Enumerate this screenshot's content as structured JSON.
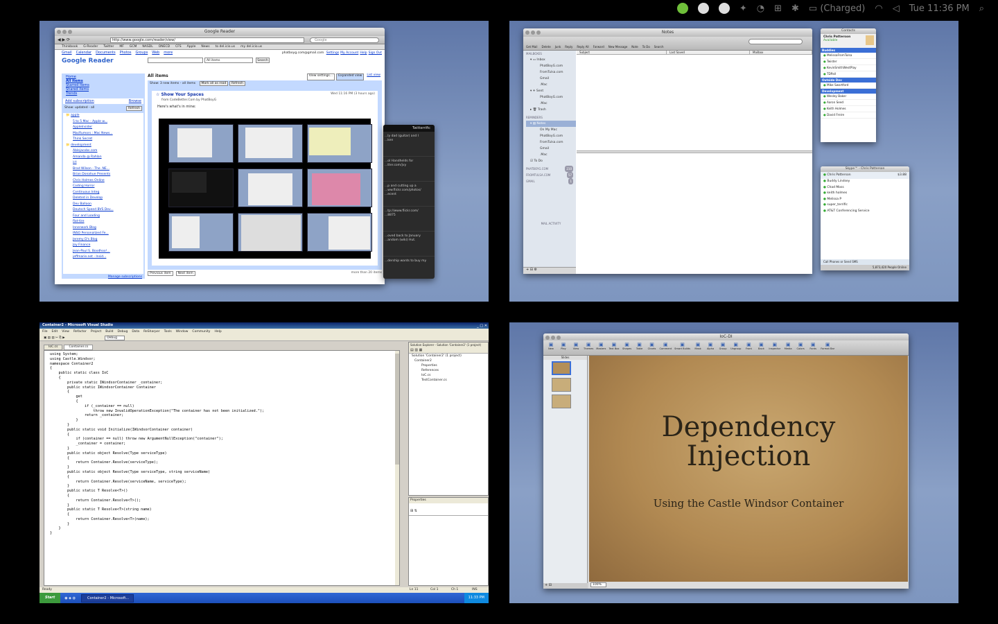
{
  "menubar": {
    "status": "(Charged)",
    "clock": "Tue 11:36 PM"
  },
  "reader": {
    "window_title": "Google Reader",
    "url": "http://www.google.com/reader/view/",
    "search_placeholder": "Google",
    "bookmarks": [
      "Thinkbook",
      "G-Reader",
      "Twitter",
      "MF",
      "GCM",
      "NASDL",
      "ONECD",
      "CFS",
      "Apple",
      "News",
      "to del.icio.us",
      "my del.icio.us"
    ],
    "google_links": [
      "Gmail",
      "Calendar",
      "Documents",
      "Photos",
      "Groups",
      "Web",
      "more"
    ],
    "account": "phatboyg.com@gmail.com",
    "account_links": [
      "Settings",
      "My Account",
      "Help",
      "Sign Out"
    ],
    "logo": "Google Reader",
    "search_select": "All items",
    "search_button": "Search",
    "nav": [
      "Home",
      "All items",
      "Starred items",
      "Shared items",
      "Trends"
    ],
    "add_subscription": "Add subscription",
    "browse": "Browse",
    "show_updated": "Show: updated - all",
    "refresh": "Refresh",
    "folder1": "apple",
    "folder2": "development",
    "feeds_apple": [
      "5 to 5 Mac - Apple w...",
      "AppleInsider",
      "MacRumors : Mac News...",
      "Think Secret"
    ],
    "feeds_dev": [
      "Ablejacobs.com",
      "Amanda @ Rahlan",
      "ict",
      "Brad Wilson - The .NE...",
      "Brian Donahue Presents",
      "Chris Holmes Online",
      "Coding Horror",
      "Continuous Integ",
      "Deleted in Develop",
      "Dev Balloon",
      "Deutsch Speed BVS Dev...",
      "Four and Loading",
      "flat-tire",
      "Innerwork Blog",
      "INSO Personalized Fe...",
      "Jeremy D's Blog",
      "Joy Finance",
      "Jean-Paul S. Boodhoo!...",
      "jeffmarie.net - Insid..."
    ],
    "manage": "Manage subscriptions",
    "heading": "All items",
    "view_settings": "View settings...",
    "expanded": "Expanded view",
    "list_view": "List view",
    "show_bar": "Show: 3 new items - all items",
    "mark_read": "Mark all as read",
    "refresh2": "Refresh",
    "post_title": "Show Your Spaces",
    "post_date": "Wed 11:16 PM (3 hours ago)",
    "post_from": "from CodeBetter.Com by PhatBoyG",
    "post_body": "Here's what's in mine:",
    "prev": "Previous item",
    "next": "Next item",
    "more_items": "more than 20 items"
  },
  "twitter": {
    "title": "Twitterrific",
    "lines": [
      "...ly dad (guitar) and I ...ken",
      "...ol Handhelds for ...tter.com/jvy",
      "...p and cutting up a ...ww.flickr.com/photos/ ...ecent",
      "...tp://www.flickr.com/ ...8875",
      "...oved back to January ...andom (wiki) Hut.",
      "...dership wants to buy my"
    ]
  },
  "mail": {
    "window_title": "Notes",
    "toolbar": [
      "Get Mail",
      "Delete",
      "Junk",
      "Reply",
      "Reply All",
      "Forward",
      "New Message",
      "Note",
      "To Do",
      "Search"
    ],
    "columns": [
      "Subject",
      "Last Saved",
      "Mailbox"
    ],
    "sections": {
      "mailboxes": "MAILBOXES",
      "reminders": "REMINDERS",
      "mail_activity": "MAIL ACTIVITY"
    },
    "inbox": "Inbox",
    "inbox_items": [
      "PhatBoyG.com",
      "FromTulsa.com",
      "Gmail",
      ".Mac"
    ],
    "sent": "Sent",
    "sent_items": [
      "PhatBoyG.com",
      ".Mac"
    ],
    "trash": "Trash",
    "notes": "Notes",
    "notes_items": [
      "On My Mac",
      "PhatBoyG.com",
      "FromTulsa.com",
      "Gmail",
      ".Mac"
    ],
    "todo": "To Do",
    "accounts": [
      "PHATBOYG.COM",
      "FROMTULSA.COM",
      "GMAIL"
    ],
    "counts": [
      "210",
      "57",
      "1"
    ]
  },
  "contacts": {
    "title": "Contacts",
    "me": "Chris Patterson",
    "status": "Available",
    "groups": [
      "Buddies",
      "Outside Dev",
      "Development"
    ],
    "buddies": [
      "MelissaFromTulsa",
      "Twister",
      "KevinSmithWestPlay",
      "TDPall"
    ],
    "outside": [
      "Mike Swartford"
    ],
    "dev": [
      "Wesley Baker",
      "Aaron Seed",
      "Keith Holmes",
      "David Freire"
    ]
  },
  "skype": {
    "title": "Skype™ - Chris Patterson",
    "me": "Chris Patterson",
    "credit": "$3.88",
    "contacts": [
      "Buddy Lindsey",
      "Chad Moss",
      "keith holmes",
      "Melissa P",
      "super_terrific",
      "AT&T Conferencing Service"
    ],
    "footer": "Call Phones or Send SMS",
    "online": "5,873,420 People Online"
  },
  "vs": {
    "window_title": "Container2 - Microsoft Visual Studio",
    "menus": [
      "File",
      "Edit",
      "View",
      "Refactor",
      "Project",
      "Build",
      "Debug",
      "Data",
      "ReSharper",
      "Tools",
      "Window",
      "Community",
      "Help"
    ],
    "config": "Debug",
    "tabs": [
      "IoC.cs",
      "Container.cs"
    ],
    "solution_title": "Solution Explorer - Solution 'Container2' (1 project)",
    "solution_items": [
      "Solution 'Container2' (1 project)",
      "Container2",
      "Properties",
      "References",
      "IoC.cs",
      "TestContainer.cs"
    ],
    "properties_title": "Properties",
    "status": "Ready",
    "status_ln": "Ln 11",
    "status_col": "Col 1",
    "status_ch": "Ch 1",
    "status_ins": "INS",
    "taskbar_start": "Start",
    "taskbar_item": "Container2 - Microsoft...",
    "taskbar_time": "11:33 PM",
    "code": [
      {
        "t": "using System;",
        "k": "u"
      },
      {
        "t": "using Castle.Windsor;",
        "k": "u"
      },
      {
        "t": "",
        "k": ""
      },
      {
        "t": "namespace Container2",
        "k": "n"
      },
      {
        "t": "{",
        "k": ""
      },
      {
        "t": "    public static class IoC",
        "k": "c"
      },
      {
        "t": "    {",
        "k": ""
      },
      {
        "t": "        private static IWindsorContainer _container;",
        "k": "f"
      },
      {
        "t": "",
        "k": ""
      },
      {
        "t": "        public static IWindsorContainer Container",
        "k": "f"
      },
      {
        "t": "        {",
        "k": ""
      },
      {
        "t": "            get",
        "k": "g"
      },
      {
        "t": "            {",
        "k": ""
      },
      {
        "t": "                if (_container == null)",
        "k": "i"
      },
      {
        "t": "                    throw new InvalidOperationException(\"The container has not been initialized.\");",
        "k": "th"
      },
      {
        "t": "",
        "k": ""
      },
      {
        "t": "                return _container;",
        "k": "r"
      },
      {
        "t": "            }",
        "k": ""
      },
      {
        "t": "        }",
        "k": ""
      },
      {
        "t": "",
        "k": ""
      },
      {
        "t": "        public static void Initialize(IWindsorContainer container)",
        "k": "f"
      },
      {
        "t": "        {",
        "k": ""
      },
      {
        "t": "            if (container == null) throw new ArgumentNullException(\"container\");",
        "k": "th"
      },
      {
        "t": "",
        "k": ""
      },
      {
        "t": "            _container = container;",
        "k": ""
      },
      {
        "t": "        }",
        "k": ""
      },
      {
        "t": "",
        "k": ""
      },
      {
        "t": "        public static object Resolve(Type serviceType)",
        "k": "f"
      },
      {
        "t": "        {",
        "k": ""
      },
      {
        "t": "            return Container.Resolve(serviceType);",
        "k": "r"
      },
      {
        "t": "        }",
        "k": ""
      },
      {
        "t": "",
        "k": ""
      },
      {
        "t": "        public static object Resolve(Type serviceType, string serviceName)",
        "k": "f"
      },
      {
        "t": "        {",
        "k": ""
      },
      {
        "t": "            return Container.Resolve(serviceName, serviceType);",
        "k": "r"
      },
      {
        "t": "        }",
        "k": ""
      },
      {
        "t": "",
        "k": ""
      },
      {
        "t": "        public static T Resolve<T>()",
        "k": "f"
      },
      {
        "t": "        {",
        "k": ""
      },
      {
        "t": "            return Container.Resolve<T>();",
        "k": "r"
      },
      {
        "t": "        }",
        "k": ""
      },
      {
        "t": "",
        "k": ""
      },
      {
        "t": "        public static T Resolve<T>(string name)",
        "k": "f"
      },
      {
        "t": "        {",
        "k": ""
      },
      {
        "t": "            return Container.Resolve<T>(name);",
        "k": "r"
      },
      {
        "t": "        }",
        "k": ""
      },
      {
        "t": "    }",
        "k": ""
      },
      {
        "t": "}",
        "k": ""
      }
    ]
  },
  "keynote": {
    "window_title": "IoC-DI",
    "toolbar": [
      "New",
      "Play",
      "View",
      "Themes",
      "Masters",
      "Text Box",
      "Shapes",
      "Table",
      "Charts",
      "Comment",
      "Smart Builds",
      "Mask",
      "Alpha",
      "Group",
      "Ungroup",
      "Front",
      "Back",
      "Inspector",
      "Media",
      "Colors",
      "Fonts",
      "Format Bar"
    ],
    "slides_label": "Slides",
    "slide_title": "Dependency Injection",
    "slide_title_l1": "Dependency",
    "slide_title_l2": "Injection",
    "slide_subtitle": "Using the Castle Windsor Container",
    "zoom": "100%"
  }
}
